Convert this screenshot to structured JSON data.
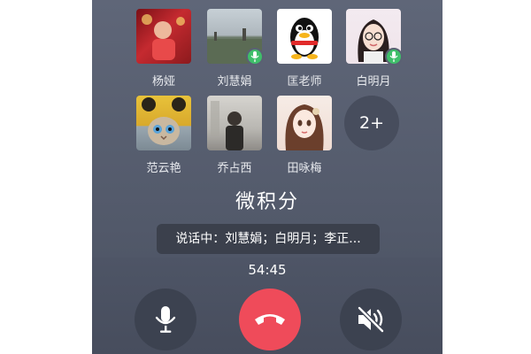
{
  "call": {
    "members": [
      {
        "name": "杨娅",
        "speaking": false,
        "avatar": "red-festive-photo"
      },
      {
        "name": "刘慧娟",
        "speaking": true,
        "avatar": "landscape-photo"
      },
      {
        "name": "匡老师",
        "speaking": false,
        "avatar": "qq-penguin"
      },
      {
        "name": "白明月",
        "speaking": true,
        "avatar": "cartoon-girl"
      },
      {
        "name": "范云艳",
        "speaking": false,
        "avatar": "cat-in-hat"
      },
      {
        "name": "乔占西",
        "speaking": false,
        "avatar": "person-photo"
      },
      {
        "name": "田咏梅",
        "speaking": false,
        "avatar": "anime-girl"
      }
    ],
    "more_label": "2+",
    "group_title": "微积分",
    "speaking_text": "说话中：刘慧娟；白明月；李正...",
    "duration": "54:45"
  },
  "controls": {
    "mute_icon": "microphone-icon",
    "hangup_icon": "phone-hangup-icon",
    "speaker_icon": "speaker-muted-icon"
  },
  "colors": {
    "background": "#5a6173",
    "hangup": "#ef4b5a",
    "speaking_badge": "#3fbf6a",
    "control": "#3c4250"
  }
}
